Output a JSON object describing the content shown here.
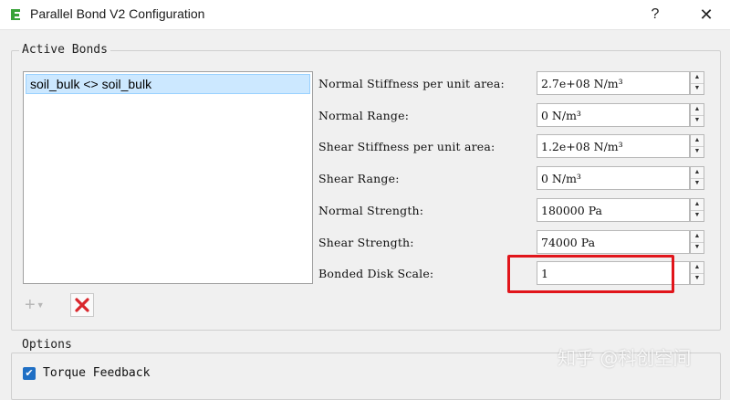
{
  "window": {
    "title": "Parallel Bond V2 Configuration",
    "help_label": "?",
    "close_label": "✕",
    "app_icon": "green-e-icon"
  },
  "active_bonds": {
    "title": "Active Bonds",
    "items": [
      "soil_bulk <> soil_bulk"
    ],
    "add_label": "+",
    "remove_icon": "red-x-icon"
  },
  "properties": [
    {
      "label": "Normal Stiffness per unit area:",
      "value": "2.7e+08 N/m³"
    },
    {
      "label": "Normal Range:",
      "value": "0 N/m³"
    },
    {
      "label": "Shear Stiffness per unit area:",
      "value": "1.2e+08 N/m³"
    },
    {
      "label": "Shear Range:",
      "value": "0 N/m³"
    },
    {
      "label": "Normal Strength:",
      "value": "180000 Pa"
    },
    {
      "label": "Shear Strength:",
      "value": "74000 Pa"
    },
    {
      "label": "Bonded Disk Scale:",
      "value": "1"
    }
  ],
  "options": {
    "title": "Options",
    "torque_feedback_label": "Torque Feedback",
    "torque_feedback_checked": true
  },
  "watermark": "知乎 @科创空间",
  "colors": {
    "highlight": "#e1151b",
    "selection": "#cce8ff",
    "checkbox": "#1f6fc4"
  }
}
